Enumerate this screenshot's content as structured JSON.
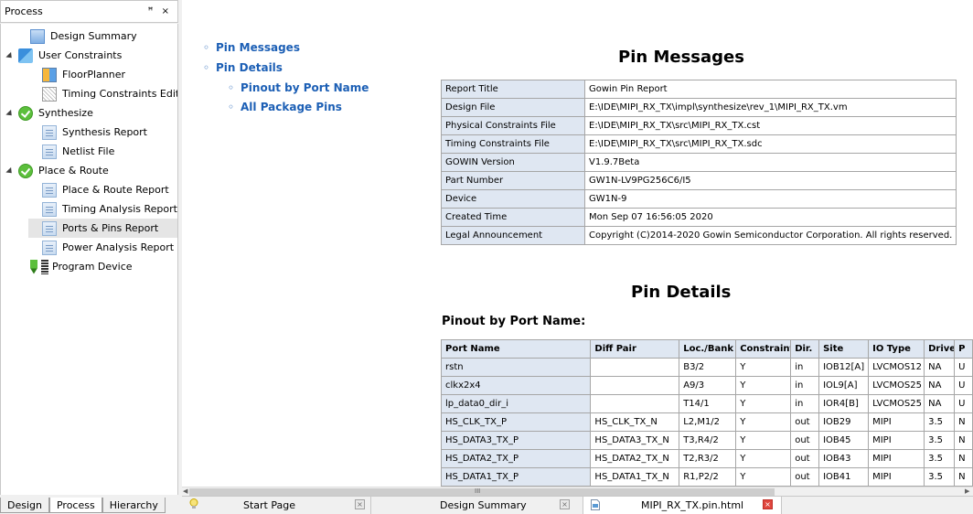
{
  "panel": {
    "title": "Process",
    "controls": "ꟸ ×",
    "items": [
      {
        "label": "Design Summary"
      },
      {
        "label": "User Constraints"
      },
      {
        "label": "FloorPlanner"
      },
      {
        "label": "Timing Constraints Editor"
      },
      {
        "label": "Synthesize"
      },
      {
        "label": "Synthesis Report"
      },
      {
        "label": "Netlist File"
      },
      {
        "label": "Place & Route"
      },
      {
        "label": "Place & Route Report"
      },
      {
        "label": "Timing Analysis Report"
      },
      {
        "label": "Ports & Pins Report"
      },
      {
        "label": "Power Analysis Report"
      },
      {
        "label": "Program Device"
      }
    ],
    "tabs": [
      "Design",
      "Process",
      "Hierarchy"
    ]
  },
  "toc": {
    "pin_messages": "Pin Messages",
    "pin_details": "Pin Details",
    "pinout_by_port": "Pinout by Port Name",
    "all_package_pins": "All Package Pins"
  },
  "report": {
    "heading_messages": "Pin Messages",
    "info": [
      {
        "k": "Report Title",
        "v": "Gowin Pin Report"
      },
      {
        "k": "Design File",
        "v": "E:\\IDE\\MIPI_RX_TX\\impl\\synthesize\\rev_1\\MIPI_RX_TX.vm"
      },
      {
        "k": "Physical Constraints File",
        "v": "E:\\IDE\\MIPI_RX_TX\\src\\MIPI_RX_TX.cst"
      },
      {
        "k": "Timing Constraints File",
        "v": "E:\\IDE\\MIPI_RX_TX\\src\\MIPI_RX_TX.sdc"
      },
      {
        "k": "GOWIN Version",
        "v": "V1.9.7Beta"
      },
      {
        "k": "Part Number",
        "v": "GW1N-LV9PG256C6/I5"
      },
      {
        "k": "Device",
        "v": "GW1N-9"
      },
      {
        "k": "Created Time",
        "v": "Mon Sep 07 16:56:05 2020"
      },
      {
        "k": "Legal Announcement",
        "v": "Copyright (C)2014-2020 Gowin Semiconductor Corporation. All rights reserved."
      }
    ],
    "heading_details": "Pin Details",
    "subheading_pinout": "Pinout by Port Name:",
    "pin_columns": [
      "Port Name",
      "Diff Pair",
      "Loc./Bank",
      "Constraint",
      "Dir.",
      "Site",
      "IO Type",
      "Drive",
      "P"
    ],
    "pin_rows": [
      [
        "rstn",
        "",
        "B3/2",
        "Y",
        "in",
        "IOB12[A]",
        "LVCMOS12",
        "NA",
        "U"
      ],
      [
        "clkx2x4",
        "",
        "A9/3",
        "Y",
        "in",
        "IOL9[A]",
        "LVCMOS25",
        "NA",
        "U"
      ],
      [
        "lp_data0_dir_i",
        "",
        "T14/1",
        "Y",
        "in",
        "IOR4[B]",
        "LVCMOS25",
        "NA",
        "U"
      ],
      [
        "HS_CLK_TX_P",
        "HS_CLK_TX_N",
        "L2,M1/2",
        "Y",
        "out",
        "IOB29",
        "MIPI",
        "3.5",
        "N"
      ],
      [
        "HS_DATA3_TX_P",
        "HS_DATA3_TX_N",
        "T3,R4/2",
        "Y",
        "out",
        "IOB45",
        "MIPI",
        "3.5",
        "N"
      ],
      [
        "HS_DATA2_TX_P",
        "HS_DATA2_TX_N",
        "T2,R3/2",
        "Y",
        "out",
        "IOB43",
        "MIPI",
        "3.5",
        "N"
      ],
      [
        "HS_DATA1_TX_P",
        "HS_DATA1_TX_N",
        "R1,P2/2",
        "Y",
        "out",
        "IOB41",
        "MIPI",
        "3.5",
        "N"
      ]
    ]
  },
  "scrollbar": {
    "grip": "III"
  },
  "doc_tabs": [
    {
      "label": "Start Page"
    },
    {
      "label": "Design Summary"
    },
    {
      "label": "MIPI_RX_TX.pin.html"
    }
  ],
  "icons": {
    "design_summary": "document-icon",
    "user_constraints": "constraints-icon",
    "floorplanner": "floorplanner-icon",
    "timing_constraints_editor": "timing-editor-icon",
    "synthesize": "check-circle-icon",
    "place_route": "check-circle-icon",
    "program_device": "download-program-icon",
    "start_page": "lightbulb-icon",
    "pin_html": "html-file-icon"
  }
}
